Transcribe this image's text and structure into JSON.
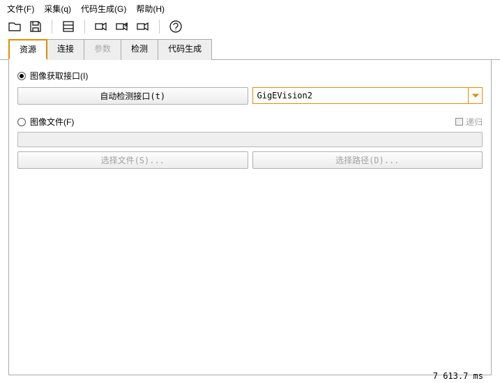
{
  "menu": {
    "file": "文件(F)",
    "acquire": "采集(q)",
    "codegen": "代码生成(G)",
    "help": "帮助(H)"
  },
  "tabs": {
    "resource": "资源",
    "connection": "连接",
    "params": "参数",
    "inspect": "检测",
    "codegen": "代码生成"
  },
  "section1": {
    "radio": "图像获取接口(I)",
    "auto": "自动检测接口(t)",
    "driver": "GigEVision2"
  },
  "section2": {
    "radio": "图像文件(F)",
    "recursive": "递归",
    "selectFile": "选择文件(S)...",
    "selectDir": "选择路径(D)..."
  },
  "status": "7  613.7 ms"
}
